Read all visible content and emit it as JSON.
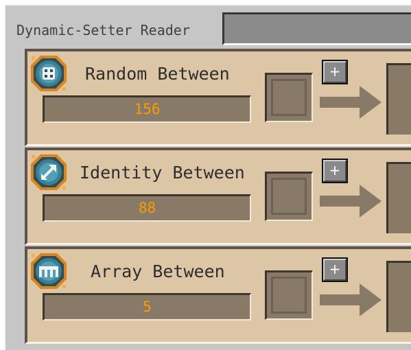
{
  "window": {
    "title": "Dynamic-Setter Reader"
  },
  "rows": [
    {
      "label": "Random Between",
      "value": "156",
      "icon": "random-dice-icon",
      "add_label": "+"
    },
    {
      "label": "Identity Between",
      "value": "88",
      "icon": "identity-arrow-icon",
      "add_label": "+"
    },
    {
      "label": "Array Between",
      "value": "5",
      "icon": "array-comb-icon",
      "add_label": "+"
    }
  ],
  "colors": {
    "value_text": "#ff9a00",
    "row_background": "#dcc6a6",
    "window_background": "#c6c6c6"
  }
}
